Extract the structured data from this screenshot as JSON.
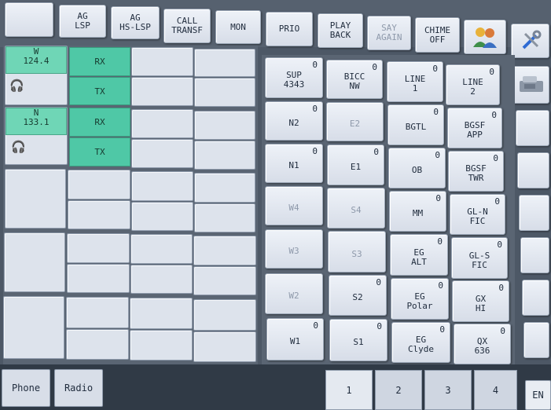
{
  "toolbar": {
    "blank": "",
    "ag_lsp": "AG\nLSP",
    "ag_hs_lsp": "AG\nHS-LSP",
    "call_transf": "CALL\nTRANSF",
    "mon": "MON",
    "prio": "PRIO",
    "play_back": "PLAY\nBACK",
    "say_again": "SAY\nAGAIN",
    "chime_off": "CHIME\nOFF",
    "users_icon": "users-icon",
    "tools_icon": "tools-icon"
  },
  "radio": {
    "positions": [
      {
        "name": "W",
        "freq": "124.4",
        "rx": "RX",
        "tx": "TX",
        "icon": "headset-icon"
      },
      {
        "name": "N",
        "freq": "133.1",
        "rx": "RX",
        "tx": "TX",
        "icon": "headset-icon"
      }
    ]
  },
  "lines": {
    "col1": [
      {
        "label": "SUP\n4343",
        "count": "0"
      },
      {
        "label": "N2",
        "count": "0"
      },
      {
        "label": "N1",
        "count": "0"
      },
      {
        "label": "W4",
        "count": ""
      },
      {
        "label": "W3",
        "count": ""
      },
      {
        "label": "W2",
        "count": ""
      },
      {
        "label": "W1",
        "count": "0"
      }
    ],
    "col2": [
      {
        "label": "BICC\nNW",
        "count": "0"
      },
      {
        "label": "E2",
        "count": ""
      },
      {
        "label": "E1",
        "count": "0"
      },
      {
        "label": "S4",
        "count": ""
      },
      {
        "label": "S3",
        "count": ""
      },
      {
        "label": "S2",
        "count": "0"
      },
      {
        "label": "S1",
        "count": "0"
      }
    ],
    "col3": [
      {
        "label": "LINE\n1",
        "count": "0"
      },
      {
        "label": "BGTL",
        "count": "0"
      },
      {
        "label": "OB",
        "count": "0"
      },
      {
        "label": "MM",
        "count": "0"
      },
      {
        "label": "EG\nALT",
        "count": "0"
      },
      {
        "label": "EG\nPolar",
        "count": "0"
      },
      {
        "label": "EG\nClyde",
        "count": "0"
      }
    ],
    "col4": [
      {
        "label": "LINE\n2",
        "count": "0"
      },
      {
        "label": "BGSF\nAPP",
        "count": "0"
      },
      {
        "label": "BGSF\nTWR",
        "count": "0"
      },
      {
        "label": "GL-N\nFIC",
        "count": "0"
      },
      {
        "label": "GL-S\nFIC",
        "count": "0"
      },
      {
        "label": "GX\nHI",
        "count": "0"
      },
      {
        "label": "QX\n636",
        "count": "0"
      }
    ]
  },
  "bottom": {
    "phone": "Phone",
    "radio": "Radio",
    "pages": [
      "1",
      "2",
      "3",
      "4"
    ],
    "lang": "EN"
  }
}
